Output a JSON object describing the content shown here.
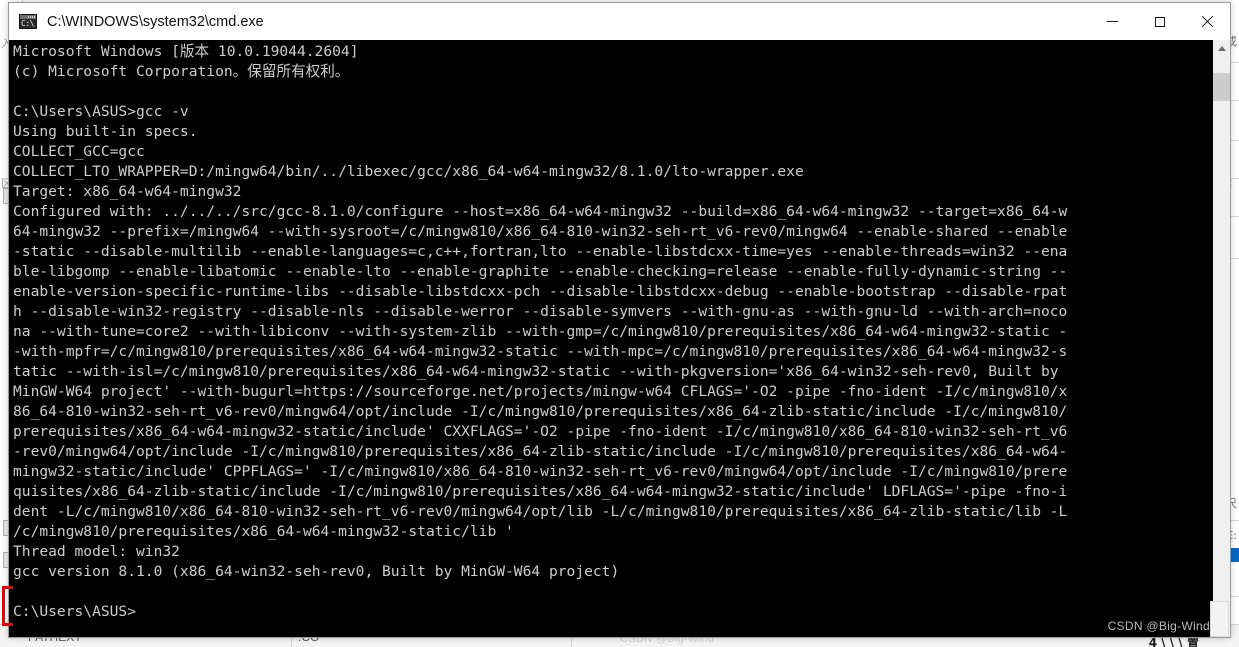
{
  "window": {
    "title": "C:\\WINDOWS\\system32\\cmd.exe",
    "icon": "cmd-console-icon",
    "icon_text": "C:\\",
    "controls": {
      "minimize": "minimize-icon",
      "maximize": "maximize-icon",
      "close": "close-icon"
    },
    "background_color": "#000000",
    "text_color": "#cccccc"
  },
  "scrollbar": {
    "up_arrow": "chevron-up-icon",
    "down_arrow": "chevron-down-icon",
    "thumb_position_percent": 3
  },
  "console": {
    "lines": [
      "Microsoft Windows [版本 10.0.19044.2604]",
      "(c) Microsoft Corporation。保留所有权利。",
      "",
      "C:\\Users\\ASUS>gcc -v",
      "Using built-in specs.",
      "COLLECT_GCC=gcc",
      "COLLECT_LTO_WRAPPER=D:/mingw64/bin/../libexec/gcc/x86_64-w64-mingw32/8.1.0/lto-wrapper.exe",
      "Target: x86_64-w64-mingw32",
      "Configured with: ../../../src/gcc-8.1.0/configure --host=x86_64-w64-mingw32 --build=x86_64-w64-mingw32 --target=x86_64-w",
      "64-mingw32 --prefix=/mingw64 --with-sysroot=/c/mingw810/x86_64-810-win32-seh-rt_v6-rev0/mingw64 --enable-shared --enable",
      "-static --disable-multilib --enable-languages=c,c++,fortran,lto --enable-libstdcxx-time=yes --enable-threads=win32 --ena",
      "ble-libgomp --enable-libatomic --enable-lto --enable-graphite --enable-checking=release --enable-fully-dynamic-string --",
      "enable-version-specific-runtime-libs --disable-libstdcxx-pch --disable-libstdcxx-debug --enable-bootstrap --disable-rpat",
      "h --disable-win32-registry --disable-nls --disable-werror --disable-symvers --with-gnu-as --with-gnu-ld --with-arch=noco",
      "na --with-tune=core2 --with-libiconv --with-system-zlib --with-gmp=/c/mingw810/prerequisites/x86_64-w64-mingw32-static -",
      "-with-mpfr=/c/mingw810/prerequisites/x86_64-w64-mingw32-static --with-mpc=/c/mingw810/prerequisites/x86_64-w64-mingw32-s",
      "tatic --with-isl=/c/mingw810/prerequisites/x86_64-w64-mingw32-static --with-pkgversion='x86_64-win32-seh-rev0, Built by",
      "MinGW-W64 project' --with-bugurl=https://sourceforge.net/projects/mingw-w64 CFLAGS='-O2 -pipe -fno-ident -I/c/mingw810/x",
      "86_64-810-win32-seh-rt_v6-rev0/mingw64/opt/include -I/c/mingw810/prerequisites/x86_64-zlib-static/include -I/c/mingw810/",
      "prerequisites/x86_64-w64-mingw32-static/include' CXXFLAGS='-O2 -pipe -fno-ident -I/c/mingw810/x86_64-810-win32-seh-rt_v6",
      "-rev0/mingw64/opt/include -I/c/mingw810/prerequisites/x86_64-zlib-static/include -I/c/mingw810/prerequisites/x86_64-w64-",
      "mingw32-static/include' CPPFLAGS=' -I/c/mingw810/x86_64-810-win32-seh-rt_v6-rev0/mingw64/opt/include -I/c/mingw810/prere",
      "quisites/x86_64-zlib-static/include -I/c/mingw810/prerequisites/x86_64-w64-mingw32-static/include' LDFLAGS='-pipe -fno-i",
      "dent -L/c/mingw810/x86_64-810-win32-seh-rt_v6-rev0/mingw64/opt/lib -L/c/mingw810/prerequisites/x86_64-zlib-static/lib -L",
      "/c/mingw810/prerequisites/x86_64-w64-mingw32-static/lib '",
      "Thread model: win32",
      "gcc version 8.1.0 (x86_64-win32-seh-rev0, Built by MinGW-W64 project)",
      "",
      "C:\\Users\\ASUS>"
    ]
  },
  "annotation": {
    "red_bracket_color": "#e8000d"
  },
  "watermark": {
    "text": "CSDN @Big-Wind"
  },
  "background": {
    "left_glyphs": [
      "入",
      "区",
      "彩"
    ],
    "right_glyphs": [
      "或",
      "文纟",
      "尺",
      "E:"
    ],
    "right_selected": "D",
    "bottom_cells": [
      "PATHEXT",
      ".CO"
    ],
    "bottom_watermark": "CSDN @Big-Wind",
    "bottom_black_text": "4 \\ \\ \\ 置"
  }
}
